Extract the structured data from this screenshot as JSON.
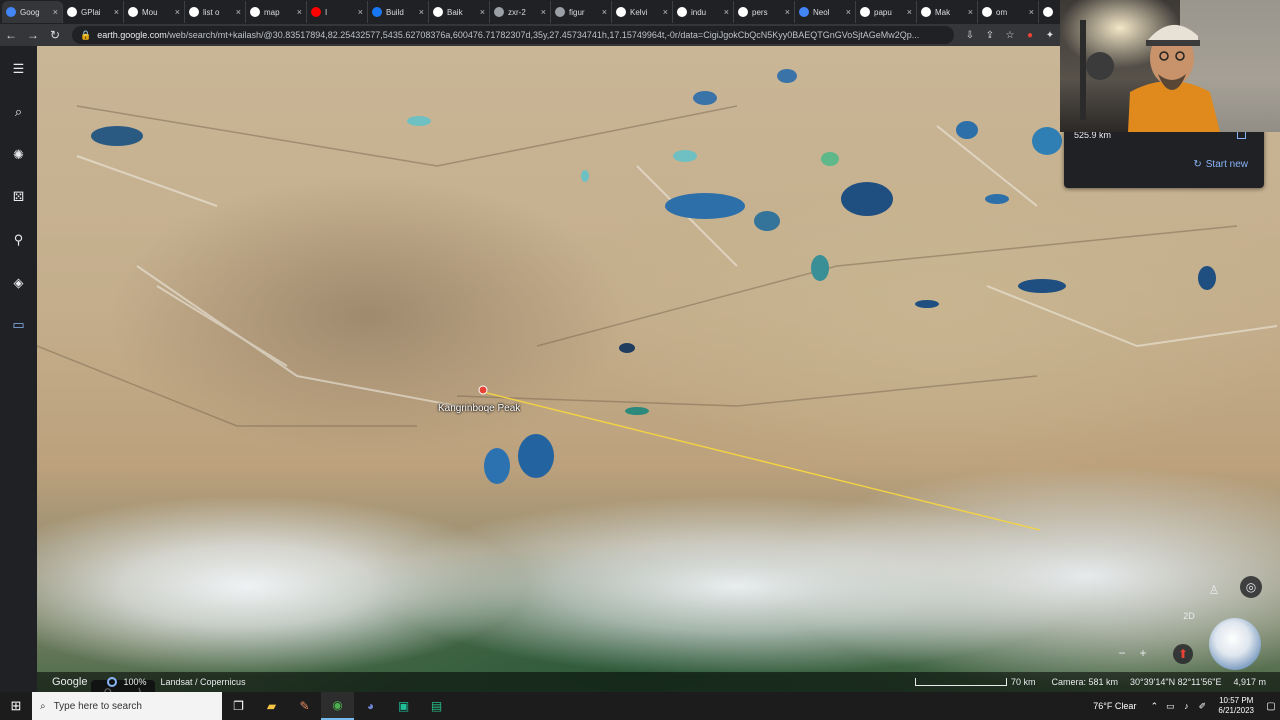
{
  "browser": {
    "tabs": [
      {
        "title": "Goog",
        "icon": "google-earth-icon",
        "color": "#4285f4",
        "active": true
      },
      {
        "title": "GPlai",
        "icon": "wikipedia-icon",
        "color": "#ffffff"
      },
      {
        "title": "Mou",
        "icon": "wikipedia-icon",
        "color": "#ffffff"
      },
      {
        "title": "list o",
        "icon": "google-icon",
        "color": "#ffffff"
      },
      {
        "title": "map",
        "icon": "google-icon",
        "color": "#ffffff"
      },
      {
        "title": "I",
        "icon": "youtube-icon",
        "color": "#ff0000"
      },
      {
        "title": "Build",
        "icon": "facebook-icon",
        "color": "#1877f2"
      },
      {
        "title": "Baik",
        "icon": "wikipedia-icon",
        "color": "#ffffff"
      },
      {
        "title": "zxr-2",
        "icon": "link-icon",
        "color": "#9aa0a6"
      },
      {
        "title": "figur",
        "icon": "link-icon",
        "color": "#9aa0a6"
      },
      {
        "title": "Kelvi",
        "icon": "wikipedia-icon",
        "color": "#ffffff"
      },
      {
        "title": "indu",
        "icon": "google-icon",
        "color": "#ffffff"
      },
      {
        "title": "pers",
        "icon": "google-icon",
        "color": "#ffffff"
      },
      {
        "title": "Neol",
        "icon": "wave-icon",
        "color": "#4285f4"
      },
      {
        "title": "papu",
        "icon": "google-icon",
        "color": "#ffffff"
      },
      {
        "title": "Mak",
        "icon": "wikipedia-icon",
        "color": "#ffffff"
      },
      {
        "title": "om",
        "icon": "google-icon",
        "color": "#ffffff"
      },
      {
        "title": "",
        "icon": "wikipedia-icon",
        "color": "#ffffff"
      }
    ],
    "url_host": "earth.google.com",
    "url_path": "/web/search/mt+kailash/@30.83517894,82.25432577,5435.62708376a,600476.71782307d,35y,27.45734741h,17.15749964t,-0r/data=CigiJgokCbQcN5Kyy0BAEQTGnGVoSjtAGeMw2Qp..."
  },
  "rail": {
    "items": [
      "menu-icon",
      "search-icon",
      "voyager-icon",
      "feeling-lucky-icon",
      "projects-icon",
      "map-style-icon",
      "measure-icon"
    ]
  },
  "map": {
    "place_label": "Kangrinboqe Peak",
    "pin_color": "#ea4335",
    "measure_line_color": "#f5d442"
  },
  "measure": {
    "distance": "525.9 km",
    "start_new": "Start new"
  },
  "controls": {
    "mode_2d": "2D",
    "zoom_out": "−",
    "zoom_in": "+"
  },
  "status": {
    "brand": "Google",
    "zoom_pct": "100%",
    "attribution": "Landsat / Copernicus",
    "scale": "70 km",
    "camera": "Camera: 581 km",
    "coords": "30°39'14\"N 82°11'56\"E",
    "elevation": "4,917 m"
  },
  "taskbar": {
    "search_placeholder": "Type here to search",
    "weather": "76°F  Clear",
    "time": "10:57 PM",
    "date": "6/21/2023"
  }
}
